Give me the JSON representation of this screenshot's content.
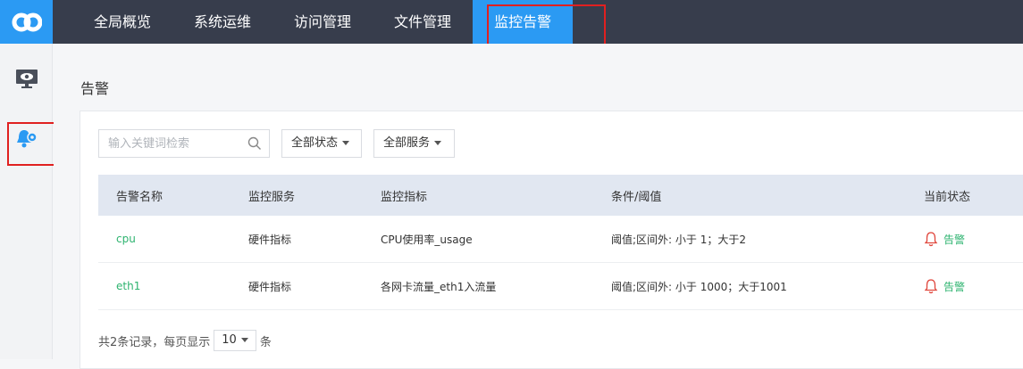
{
  "header": {
    "logo_text": "co",
    "nav": [
      {
        "label": "全局概览"
      },
      {
        "label": "系统运维"
      },
      {
        "label": "访问管理"
      },
      {
        "label": "文件管理"
      },
      {
        "label": "监控告警"
      }
    ],
    "active_nav": "监控告警"
  },
  "sidebar": {
    "items": [
      {
        "icon": "monitor-eye-icon"
      },
      {
        "icon": "bell-gear-icon"
      }
    ]
  },
  "page": {
    "title": "告警"
  },
  "filters": {
    "search_placeholder": "输入关键词检索",
    "status_label": "全部状态",
    "service_label": "全部服务"
  },
  "table": {
    "headers": [
      "告警名称",
      "监控服务",
      "监控指标",
      "条件/阈值",
      "当前状态"
    ],
    "rows": [
      {
        "name": "cpu",
        "service": "硬件指标",
        "metric": "CPU使用率_usage",
        "condition": "阈值;区间外: 小于 1；大于2",
        "status": "告警"
      },
      {
        "name": "eth1",
        "service": "硬件指标",
        "metric": "各网卡流量_eth1入流量",
        "condition": "阈值;区间外: 小于 1000；大于1001",
        "status": "告警"
      }
    ]
  },
  "pager": {
    "summary": "共2条记录，每页显示",
    "page_size": "10",
    "suffix": "条"
  },
  "colors": {
    "accent": "#2b9af3",
    "topbar": "#373d4c",
    "link_green": "#2db36f",
    "alarm_red": "#e0463c",
    "highlight": "#e02020"
  }
}
